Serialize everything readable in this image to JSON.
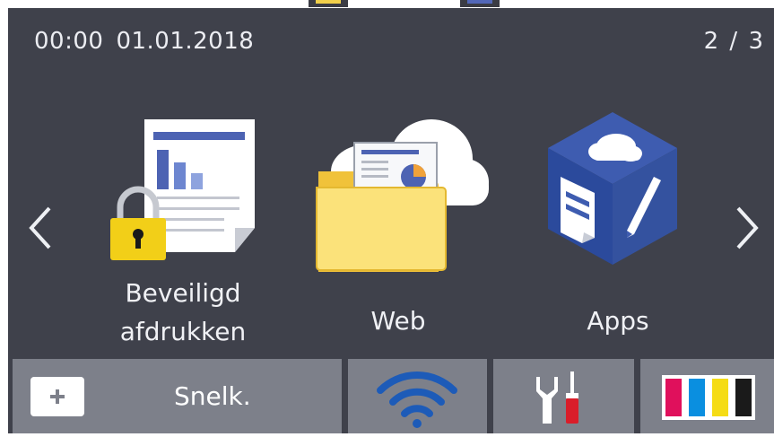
{
  "status": {
    "time": "00:00",
    "date": "01.01.2018",
    "page_indicator": "2 / 3"
  },
  "apps": [
    {
      "id": "secure-print",
      "label_line1": "Beveiligd",
      "label_line2": "afdrukken",
      "icon": "secure-print-icon"
    },
    {
      "id": "web",
      "label": "Web",
      "icon": "web-cloud-folder-icon"
    },
    {
      "id": "apps",
      "label": "Apps",
      "icon": "apps-cube-icon"
    }
  ],
  "nav": {
    "prev_icon": "chevron-left-icon",
    "next_icon": "chevron-right-icon"
  },
  "bottom_bar": {
    "shortcut_label": "Snelk.",
    "shortcut_icon": "plus-icon",
    "wifi_icon": "wifi-icon",
    "tools_icon": "settings-tools-icon",
    "ink_icon": "ink-cartridges-icon"
  },
  "colors": {
    "screen_bg": "#3f414b",
    "button_bg": "#7d808a",
    "wifi_blue": "#1d5bb8",
    "ink_magenta": "#e0105c",
    "ink_cyan": "#0a8fe0",
    "ink_yellow": "#f5dc15",
    "ink_black": "#1a1a1a"
  }
}
